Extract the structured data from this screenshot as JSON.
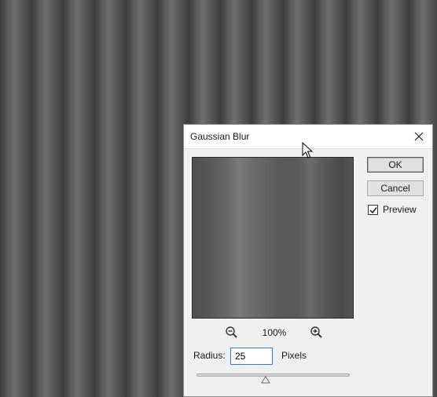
{
  "dialog": {
    "title": "Gaussian Blur",
    "ok_label": "OK",
    "cancel_label": "Cancel",
    "preview_label": "Preview",
    "preview_checked": true,
    "zoom_level": "100%",
    "radius_label": "Radius:",
    "radius_value": "25",
    "units_label": "Pixels",
    "radius_slider_fraction": 0.45
  },
  "icons": {
    "close": "close-icon",
    "zoom_out": "zoom-out-icon",
    "zoom_in": "zoom-in-icon",
    "checkmark": "checkmark-icon",
    "slider_thumb": "slider-thumb-icon",
    "cursor": "mouse-pointer-icon"
  },
  "colors": {
    "dialog_bg": "#f0f0f0",
    "titlebar_bg": "#ffffff",
    "input_focus_border": "#3c78c8"
  }
}
